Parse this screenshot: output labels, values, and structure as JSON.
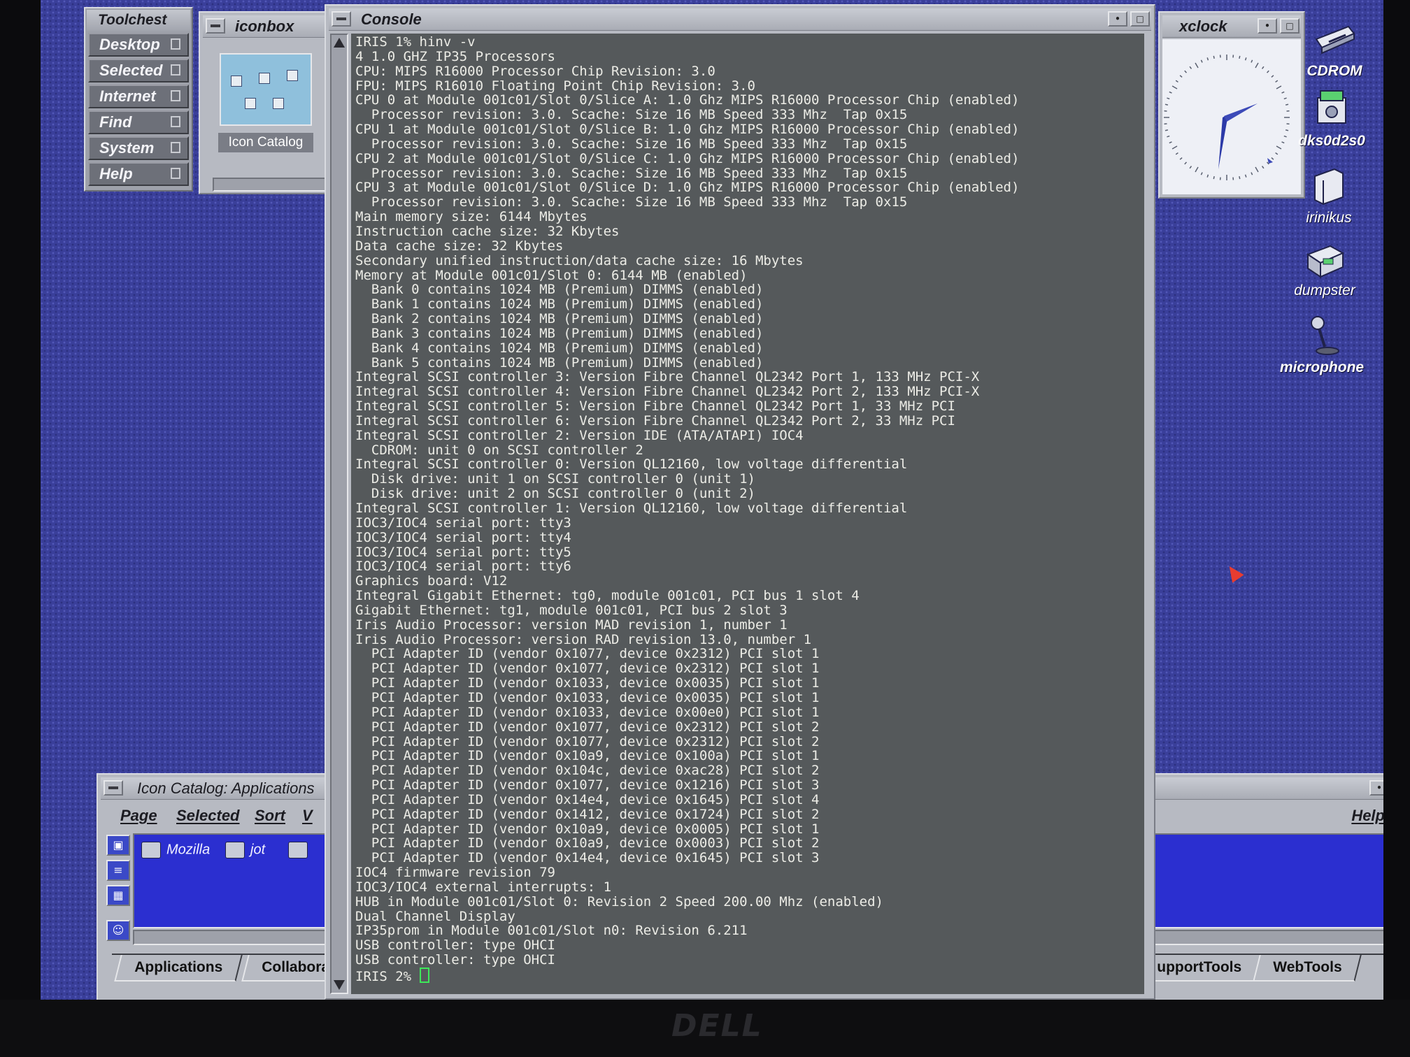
{
  "toolchest": {
    "title": "Toolchest",
    "items": [
      "Desktop",
      "Selected",
      "Internet",
      "Find",
      "System",
      "Help"
    ]
  },
  "iconbox": {
    "title": "iconbox",
    "item_label": "Icon Catalog"
  },
  "console": {
    "title": "Console",
    "lines": [
      "IRIS 1% hinv -v",
      "4 1.0 GHZ IP35 Processors",
      "CPU: MIPS R16000 Processor Chip Revision: 3.0",
      "FPU: MIPS R16010 Floating Point Chip Revision: 3.0",
      "CPU 0 at Module 001c01/Slot 0/Slice A: 1.0 Ghz MIPS R16000 Processor Chip (enabled)",
      "  Processor revision: 3.0. Scache: Size 16 MB Speed 333 Mhz  Tap 0x15",
      "CPU 1 at Module 001c01/Slot 0/Slice B: 1.0 Ghz MIPS R16000 Processor Chip (enabled)",
      "  Processor revision: 3.0. Scache: Size 16 MB Speed 333 Mhz  Tap 0x15",
      "CPU 2 at Module 001c01/Slot 0/Slice C: 1.0 Ghz MIPS R16000 Processor Chip (enabled)",
      "  Processor revision: 3.0. Scache: Size 16 MB Speed 333 Mhz  Tap 0x15",
      "CPU 3 at Module 001c01/Slot 0/Slice D: 1.0 Ghz MIPS R16000 Processor Chip (enabled)",
      "  Processor revision: 3.0. Scache: Size 16 MB Speed 333 Mhz  Tap 0x15",
      "Main memory size: 6144 Mbytes",
      "Instruction cache size: 32 Kbytes",
      "Data cache size: 32 Kbytes",
      "Secondary unified instruction/data cache size: 16 Mbytes",
      "Memory at Module 001c01/Slot 0: 6144 MB (enabled)",
      "  Bank 0 contains 1024 MB (Premium) DIMMS (enabled)",
      "  Bank 1 contains 1024 MB (Premium) DIMMS (enabled)",
      "  Bank 2 contains 1024 MB (Premium) DIMMS (enabled)",
      "  Bank 3 contains 1024 MB (Premium) DIMMS (enabled)",
      "  Bank 4 contains 1024 MB (Premium) DIMMS (enabled)",
      "  Bank 5 contains 1024 MB (Premium) DIMMS (enabled)",
      "Integral SCSI controller 3: Version Fibre Channel QL2342 Port 1, 133 MHz PCI-X",
      "Integral SCSI controller 4: Version Fibre Channel QL2342 Port 2, 133 MHz PCI-X",
      "Integral SCSI controller 5: Version Fibre Channel QL2342 Port 1, 33 MHz PCI",
      "Integral SCSI controller 6: Version Fibre Channel QL2342 Port 2, 33 MHz PCI",
      "Integral SCSI controller 2: Version IDE (ATA/ATAPI) IOC4",
      "  CDROM: unit 0 on SCSI controller 2",
      "Integral SCSI controller 0: Version QL12160, low voltage differential",
      "  Disk drive: unit 1 on SCSI controller 0 (unit 1)",
      "  Disk drive: unit 2 on SCSI controller 0 (unit 2)",
      "Integral SCSI controller 1: Version QL12160, low voltage differential",
      "IOC3/IOC4 serial port: tty3",
      "IOC3/IOC4 serial port: tty4",
      "IOC3/IOC4 serial port: tty5",
      "IOC3/IOC4 serial port: tty6",
      "Graphics board: V12",
      "Integral Gigabit Ethernet: tg0, module 001c01, PCI bus 1 slot 4",
      "Gigabit Ethernet: tg1, module 001c01, PCI bus 2 slot 3",
      "Iris Audio Processor: version MAD revision 1, number 1",
      "Iris Audio Processor: version RAD revision 13.0, number 1",
      "  PCI Adapter ID (vendor 0x1077, device 0x2312) PCI slot 1",
      "  PCI Adapter ID (vendor 0x1077, device 0x2312) PCI slot 1",
      "  PCI Adapter ID (vendor 0x1033, device 0x0035) PCI slot 1",
      "  PCI Adapter ID (vendor 0x1033, device 0x0035) PCI slot 1",
      "  PCI Adapter ID (vendor 0x1033, device 0x00e0) PCI slot 1",
      "  PCI Adapter ID (vendor 0x1077, device 0x2312) PCI slot 2",
      "  PCI Adapter ID (vendor 0x1077, device 0x2312) PCI slot 2",
      "  PCI Adapter ID (vendor 0x10a9, device 0x100a) PCI slot 1",
      "  PCI Adapter ID (vendor 0x104c, device 0xac28) PCI slot 2",
      "  PCI Adapter ID (vendor 0x1077, device 0x1216) PCI slot 3",
      "  PCI Adapter ID (vendor 0x14e4, device 0x1645) PCI slot 4",
      "  PCI Adapter ID (vendor 0x1412, device 0x1724) PCI slot 2",
      "  PCI Adapter ID (vendor 0x10a9, device 0x0005) PCI slot 1",
      "  PCI Adapter ID (vendor 0x10a9, device 0x0003) PCI slot 2",
      "  PCI Adapter ID (vendor 0x14e4, device 0x1645) PCI slot 3",
      "IOC4 firmware revision 79",
      "IOC3/IOC4 external interrupts: 1",
      "HUB in Module 001c01/Slot 0: Revision 2 Speed 200.00 Mhz (enabled)",
      "Dual Channel Display",
      "IP35prom in Module 001c01/Slot n0: Revision 6.211",
      "USB controller: type OHCI",
      "USB controller: type OHCI"
    ],
    "prompt": "IRIS 2% "
  },
  "xclock": {
    "title": "xclock"
  },
  "catalog": {
    "title": "Icon Catalog: Applications",
    "menus": [
      "Page",
      "Selected",
      "Sort",
      "V"
    ],
    "help": "Help",
    "apps": [
      "Mozilla",
      "jot"
    ],
    "tabs_left": [
      "Applications",
      "Collaborati"
    ],
    "tabs_right": [
      "upportTools",
      "WebTools"
    ]
  },
  "desktop_icons": [
    {
      "label": "CDROM",
      "icon": "cdrom-icon"
    },
    {
      "label": "dks0d2s0",
      "icon": "disk-icon"
    },
    {
      "label": "irinikus",
      "icon": "home-folder-icon"
    },
    {
      "label": "dumpster",
      "icon": "dumpster-icon"
    },
    {
      "label": "microphone",
      "icon": "microphone-icon"
    }
  ],
  "monitor": {
    "brand": "DELL"
  },
  "colors": {
    "desktop": "#3a3f9a",
    "console_bg": "#55595b",
    "console_fg": "#ecece6",
    "cursor": "#3ee85a",
    "catalog_pane": "#2b2fd0"
  }
}
